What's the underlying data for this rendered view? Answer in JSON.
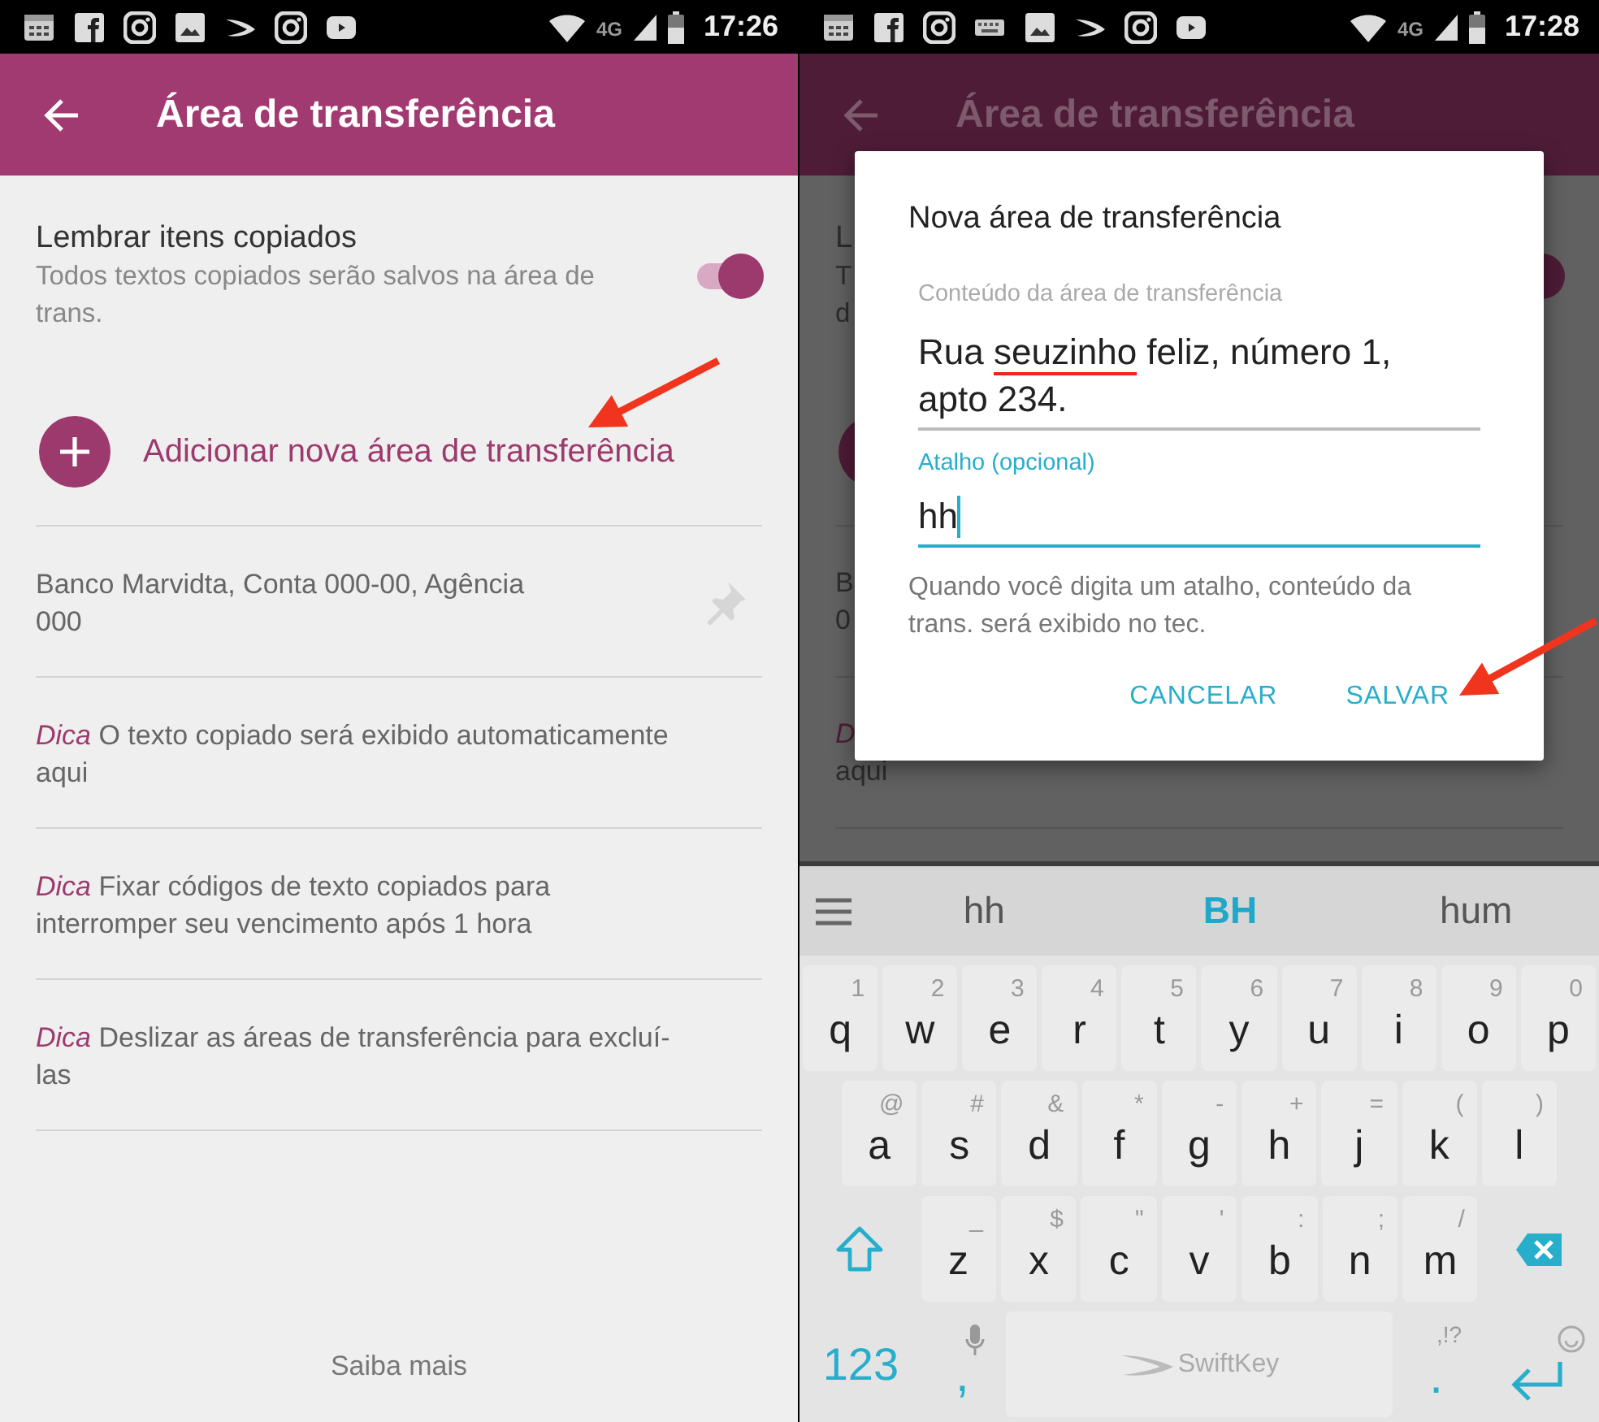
{
  "screens": [
    {
      "status_bar": {
        "notifications": [
          {
            "kind": "calendar"
          },
          {
            "kind": "facebook"
          },
          {
            "kind": "instagram"
          },
          {
            "kind": "image"
          },
          {
            "kind": "swirl"
          },
          {
            "kind": "instagram"
          },
          {
            "kind": "video"
          }
        ],
        "network": "4G",
        "time": "17:26"
      },
      "app_bar": {
        "title": "Área de transferência"
      },
      "setting": {
        "title": "Lembrar itens copiados",
        "description": "Todos textos copiados serão salvos na área de trans.",
        "on": true
      },
      "add_action": {
        "label": "Adicionar nova área de transferência"
      },
      "items": [
        {
          "kind": "clip",
          "text": "Banco Marvidta, Conta 000-00, Agência 000"
        },
        {
          "kind": "tip",
          "tag": "Dica",
          "text": "O texto copiado será exibido automaticamente aqui"
        },
        {
          "kind": "tip",
          "tag": "Dica",
          "text": "Fixar códigos de texto copiados para interromper seu vencimento após 1 hora"
        },
        {
          "kind": "tip",
          "tag": "Dica",
          "text": "Deslizar as áreas de transferência para excluí-las"
        }
      ],
      "footer_link": "Saiba mais",
      "annotation": {
        "kind": "arrow"
      }
    },
    {
      "status_bar": {
        "notifications": [
          {
            "kind": "calendar"
          },
          {
            "kind": "facebook"
          },
          {
            "kind": "instagram"
          },
          {
            "kind": "keyboard"
          },
          {
            "kind": "image"
          },
          {
            "kind": "swirl"
          },
          {
            "kind": "instagram"
          },
          {
            "kind": "video"
          }
        ],
        "network": "4G",
        "time": "17:28"
      },
      "app_bar": {
        "title": "Área de transferência"
      },
      "background_rows": [
        {
          "kind": "setting",
          "lines": [
            "L",
            "T",
            "d"
          ],
          "on": true
        },
        {
          "kind": "add"
        },
        {
          "kind": "clip",
          "lines": [
            "B",
            "0"
          ]
        },
        {
          "kind": "tip",
          "lines": [
            "D",
            "aqui"
          ]
        }
      ],
      "dialog": {
        "title": "Nova área de transferência",
        "content_label": "Conteúdo da área de transferência",
        "content_value": [
          {
            "text": "Rua ",
            "misspelled": false
          },
          {
            "text": "seuzinho",
            "misspelled": true
          },
          {
            "text": " feliz, número 1, apto 234.",
            "misspelled": false
          }
        ],
        "shortcut_label": "Atalho (opcional)",
        "shortcut_value": "hh",
        "helper": "Quando você digita um atalho, conteúdo da trans. será exibido no tec.",
        "buttons": [
          "CANCELAR",
          "SALVAR"
        ]
      },
      "keyboard": {
        "suggestions": [
          {
            "text": "hh",
            "selected": false
          },
          {
            "text": "BH",
            "selected": true
          },
          {
            "text": "hum",
            "selected": false
          }
        ],
        "rows": [
          {
            "keys": [
              {
                "kind": "char",
                "label": "q",
                "hint": "1"
              },
              {
                "kind": "char",
                "label": "w",
                "hint": "2"
              },
              {
                "kind": "char",
                "label": "e",
                "hint": "3"
              },
              {
                "kind": "char",
                "label": "r",
                "hint": "4"
              },
              {
                "kind": "char",
                "label": "t",
                "hint": "5"
              },
              {
                "kind": "char",
                "label": "y",
                "hint": "6"
              },
              {
                "kind": "char",
                "label": "u",
                "hint": "7"
              },
              {
                "kind": "char",
                "label": "i",
                "hint": "8"
              },
              {
                "kind": "char",
                "label": "o",
                "hint": "9"
              },
              {
                "kind": "char",
                "label": "p",
                "hint": "0"
              }
            ]
          },
          {
            "keys": [
              {
                "kind": "char",
                "label": "a",
                "hint": "@"
              },
              {
                "kind": "char",
                "label": "s",
                "hint": "#"
              },
              {
                "kind": "char",
                "label": "d",
                "hint": "&"
              },
              {
                "kind": "char",
                "label": "f",
                "hint": "*"
              },
              {
                "kind": "char",
                "label": "g",
                "hint": "-"
              },
              {
                "kind": "char",
                "label": "h",
                "hint": "+"
              },
              {
                "kind": "char",
                "label": "j",
                "hint": "="
              },
              {
                "kind": "char",
                "label": "k",
                "hint": "("
              },
              {
                "kind": "char",
                "label": "l",
                "hint": ")"
              }
            ]
          },
          {
            "keys": [
              {
                "kind": "shift"
              },
              {
                "kind": "char",
                "label": "z",
                "hint": "_"
              },
              {
                "kind": "char",
                "label": "x",
                "hint": "$"
              },
              {
                "kind": "char",
                "label": "c",
                "hint": "\""
              },
              {
                "kind": "char",
                "label": "v",
                "hint": "'"
              },
              {
                "kind": "char",
                "label": "b",
                "hint": ":"
              },
              {
                "kind": "char",
                "label": "n",
                "hint": ";"
              },
              {
                "kind": "char",
                "label": "m",
                "hint": "/"
              },
              {
                "kind": "backspace"
              }
            ]
          },
          {
            "keys": [
              {
                "kind": "mode",
                "label": "123"
              },
              {
                "kind": "comma",
                "label": ","
              },
              {
                "kind": "space",
                "label": "SwiftKey"
              },
              {
                "kind": "punct",
                "label": ".",
                "hint": ",!?"
              },
              {
                "kind": "enter"
              }
            ]
          }
        ]
      },
      "annotation": {
        "kind": "arrow"
      }
    }
  ]
}
